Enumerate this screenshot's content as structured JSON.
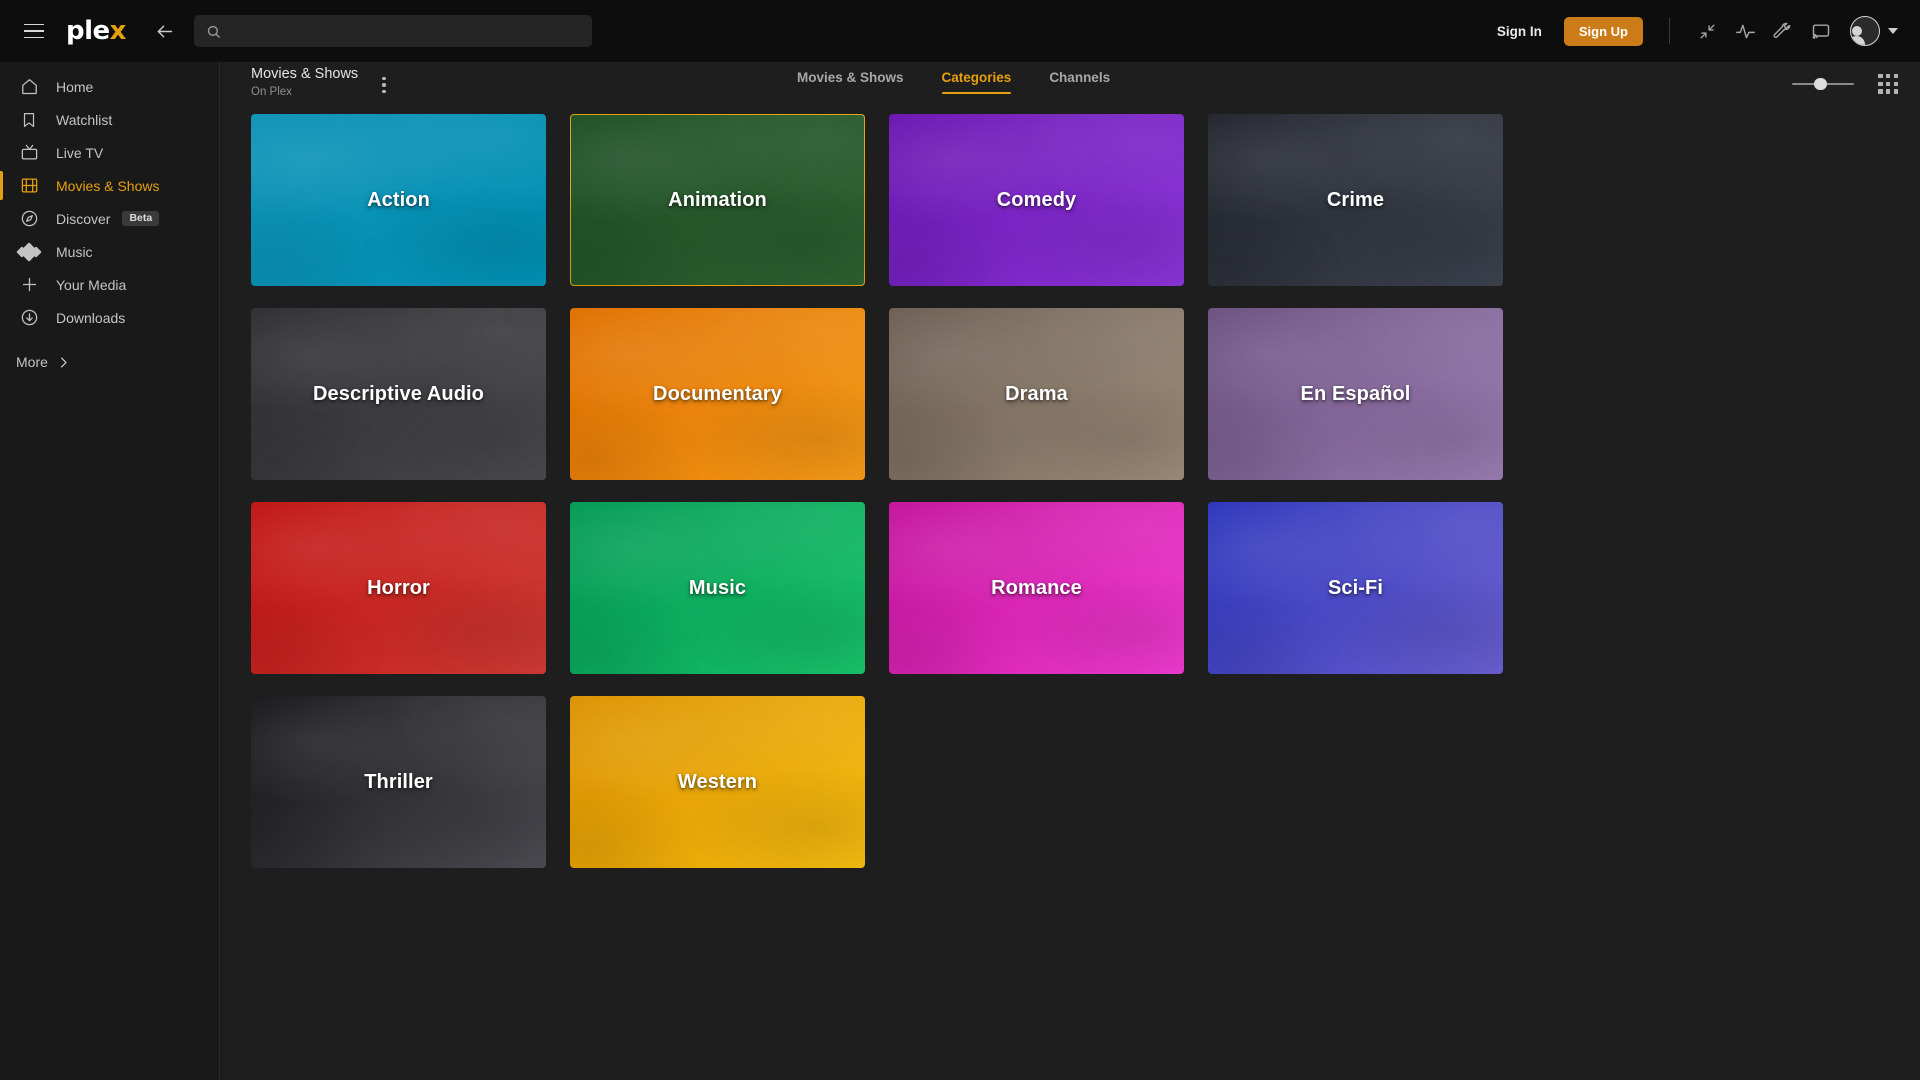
{
  "header": {
    "logo_text_main": "ple",
    "logo_text_accent": "x",
    "menu_icon": "hamburger-icon",
    "back_icon": "back-arrow-icon",
    "search": {
      "value": "",
      "placeholder": ""
    },
    "sign_in_label": "Sign In",
    "sign_up_label": "Sign Up",
    "icons": [
      "collapse-icon",
      "activity-icon",
      "wrench-icon",
      "cast-icon",
      "avatar"
    ],
    "accent_color": "#e5a00d",
    "signup_bg": "#cc7b19"
  },
  "sidebar": {
    "items": [
      {
        "label": "Home",
        "icon": "home-icon",
        "active": false
      },
      {
        "label": "Watchlist",
        "icon": "bookmark-icon",
        "active": false
      },
      {
        "label": "Live TV",
        "icon": "tv-icon",
        "active": false
      },
      {
        "label": "Movies & Shows",
        "icon": "film-icon",
        "active": true
      },
      {
        "label": "Discover",
        "icon": "compass-icon",
        "active": false,
        "badge": "Beta"
      },
      {
        "label": "Music",
        "icon": "music-diamonds-icon",
        "active": false
      },
      {
        "label": "Your Media",
        "icon": "plus-icon",
        "active": false
      },
      {
        "label": "Downloads",
        "icon": "download-circle-icon",
        "active": false
      }
    ],
    "more_label": "More"
  },
  "main": {
    "title": "Movies & Shows",
    "subtitle": "On Plex",
    "kebab_icon": "more-options-icon",
    "tabs": [
      {
        "label": "Movies & Shows",
        "active": false
      },
      {
        "label": "Categories",
        "active": true
      },
      {
        "label": "Channels",
        "active": false
      }
    ],
    "view_controls": {
      "slider_icon": "size-slider",
      "slider_value": 40,
      "grid_icon": "grid-view-icon"
    },
    "categories": [
      {
        "label": "Action",
        "color_start": "#0e93b8",
        "color_end": "#0090b4",
        "focused": false
      },
      {
        "label": "Animation",
        "color_start": "#1e4f24",
        "color_end": "#2d6030",
        "focused": true
      },
      {
        "label": "Comedy",
        "color_start": "#6a15b0",
        "color_end": "#8b34d8",
        "focused": false
      },
      {
        "label": "Crime",
        "color_start": "#22252e",
        "color_end": "#3c424e",
        "focused": false
      },
      {
        "label": "Descriptive Audio",
        "color_start": "#2e2e32",
        "color_end": "#4a4a4e",
        "focused": false
      },
      {
        "label": "Documentary",
        "color_start": "#e07000",
        "color_end": "#f59a18",
        "focused": false
      },
      {
        "label": "Drama",
        "color_start": "#6b5e52",
        "color_end": "#9c8b79",
        "focused": false
      },
      {
        "label": "En Español",
        "color_start": "#6b5080",
        "color_end": "#9a7cb0",
        "focused": false
      },
      {
        "label": "Horror",
        "color_start": "#c01412",
        "color_end": "#cf3a34",
        "focused": false
      },
      {
        "label": "Music",
        "color_start": "#029a53",
        "color_end": "#18c26a",
        "focused": false
      },
      {
        "label": "Romance",
        "color_start": "#c4129c",
        "color_end": "#ef3bd0",
        "focused": false
      },
      {
        "label": "Sci-Fi",
        "color_start": "#2b35bb",
        "color_end": "#6a5fd0",
        "focused": false
      },
      {
        "label": "Thriller",
        "color_start": "#17171a",
        "color_end": "#4c4c52",
        "focused": false
      },
      {
        "label": "Western",
        "color_start": "#dc9200",
        "color_end": "#f5bb10",
        "focused": false
      }
    ]
  }
}
